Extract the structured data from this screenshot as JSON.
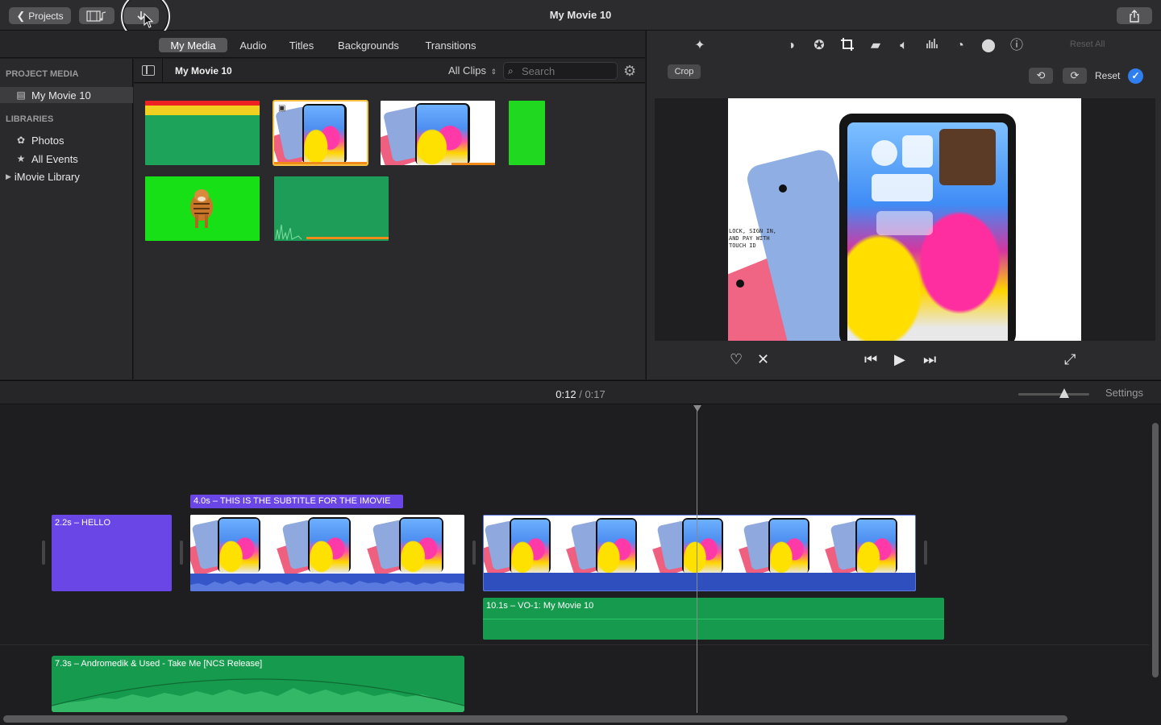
{
  "toolbar": {
    "projects_label": "Projects",
    "window_title": "My Movie 10"
  },
  "browser_tabs": [
    {
      "label": "My Media",
      "active": true
    },
    {
      "label": "Audio",
      "active": false
    },
    {
      "label": "Titles",
      "active": false
    },
    {
      "label": "Backgrounds",
      "active": false
    },
    {
      "label": "Transitions",
      "active": false
    }
  ],
  "sidebar": {
    "project_media_heading": "PROJECT MEDIA",
    "project_item": "My Movie 10",
    "libraries_heading": "LIBRARIES",
    "items": [
      {
        "label": "Photos",
        "icon": "flower-icon"
      },
      {
        "label": "All Events",
        "icon": "star-icon"
      },
      {
        "label": "iMovie Library",
        "icon": "disclosure-triangle-icon"
      }
    ]
  },
  "library": {
    "title": "My Movie 10",
    "filter": "All Clips",
    "search_placeholder": "Search"
  },
  "viewer": {
    "reset_all": "Reset All",
    "crop_label": "Crop",
    "reset_label": "Reset",
    "preview_tagline": "LOCK, SIGN IN,\nAND PAY WITH\nTOUCH ID"
  },
  "timeline": {
    "current_time": "0:12",
    "separator": "/",
    "total_time": "0:17",
    "settings_label": "Settings",
    "clips": {
      "hello_title": "2.2s – HELLO",
      "subtitle_title": "4.0s – THIS IS THE SUBTITLE FOR THE IMOVIE",
      "voiceover": "10.1s – VO-1: My Movie 10",
      "music": "7.3s – Andromedik & Used - Take Me [NCS Release]"
    }
  },
  "colors": {
    "title_clip": "#6b46e6",
    "audio_clip": "#169a4e",
    "video_audio": "#3556c8",
    "selection": "#f5c242",
    "accent_blue": "#2f7ff0"
  }
}
